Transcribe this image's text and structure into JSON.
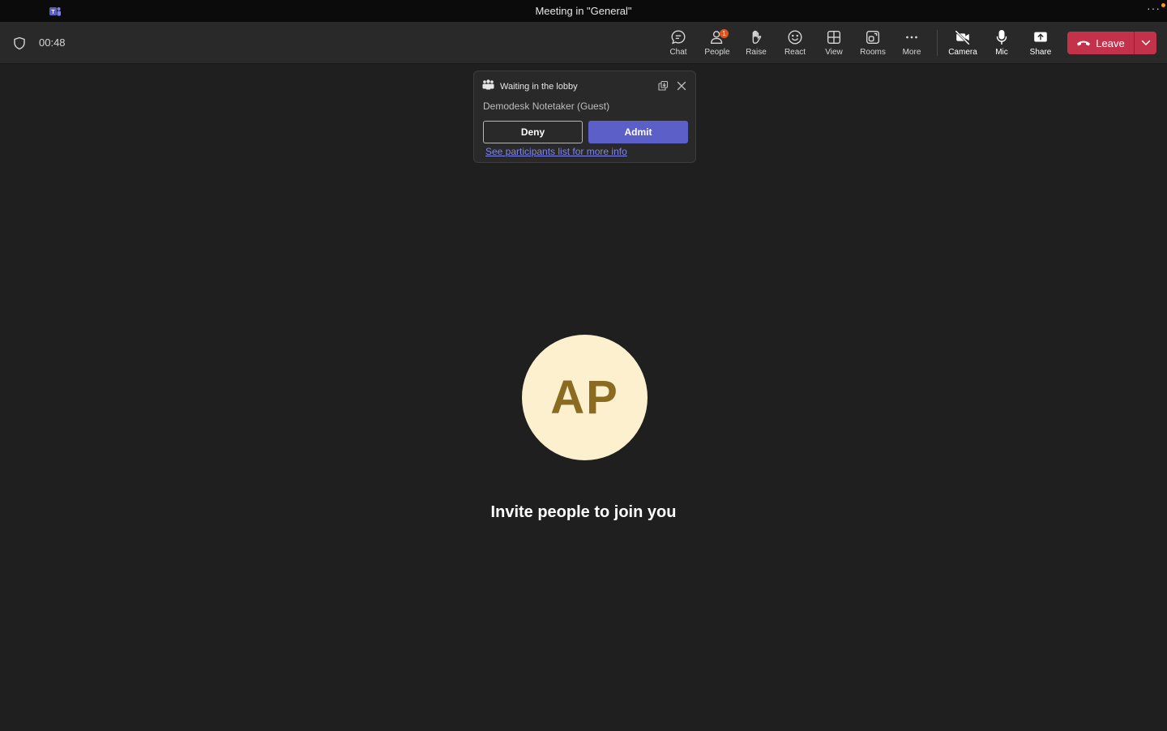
{
  "window": {
    "title": "Meeting in \"General\"",
    "more_glyph": "···"
  },
  "toolbar": {
    "timer": "00:48",
    "buttons": [
      {
        "label": "Chat",
        "icon": "chat-icon"
      },
      {
        "label": "People",
        "icon": "people-icon",
        "badge": "1"
      },
      {
        "label": "Raise",
        "icon": "raise-hand-icon"
      },
      {
        "label": "React",
        "icon": "react-smile-icon"
      },
      {
        "label": "View",
        "icon": "view-grid-icon"
      },
      {
        "label": "Rooms",
        "icon": "rooms-icon"
      },
      {
        "label": "More",
        "icon": "more-dots-icon"
      },
      {
        "label": "Camera",
        "icon": "camera-off-icon"
      },
      {
        "label": "Mic",
        "icon": "mic-icon"
      },
      {
        "label": "Share",
        "icon": "share-icon"
      }
    ],
    "leave_label": "Leave"
  },
  "lobby": {
    "title": "Waiting in the lobby",
    "guest": "Demodesk Notetaker (Guest)",
    "deny_label": "Deny",
    "admit_label": "Admit",
    "link_text": "See participants list for more info"
  },
  "stage": {
    "avatar_initials": "AP",
    "invite_text": "Invite people to join you"
  },
  "colors": {
    "background": "#1f1f1f",
    "toolbar": "#292929",
    "leave": "#c4314b",
    "admit": "#5b5fc7",
    "link": "#7f85f5",
    "avatar_bg": "#fcf0cf",
    "avatar_text": "#8a6b1f",
    "badge": "#e0531f"
  }
}
